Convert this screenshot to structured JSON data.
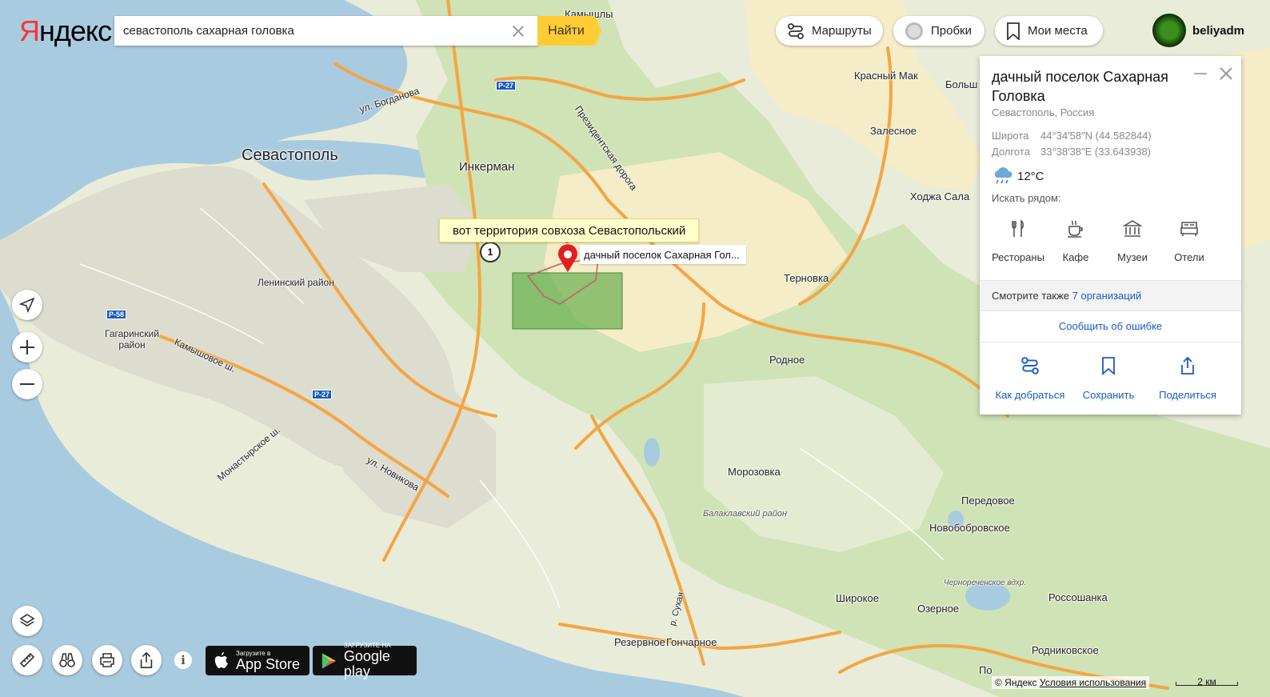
{
  "header": {
    "logo": "Яндекс",
    "search_value": "севастополь сахарная головка",
    "find_label": "Найти",
    "routes_label": "Маршруты",
    "traffic_label": "Пробки",
    "places_label": "Мои места",
    "username": "beliyadm"
  },
  "panel": {
    "title": "дачный поселок Сахарная Головка",
    "subtitle": "Севастополь, Россия",
    "lat_label": "Широта",
    "lat_value": "44°34′58″N (44.582844)",
    "lon_label": "Долгота",
    "lon_value": "33°38′38″E (33.643938)",
    "temperature": "12°C",
    "weather_icon": "rain-cloud-icon",
    "nearby_label": "Искать рядом:",
    "categories": [
      {
        "label": "Рестораны",
        "icon": "fork-knife-icon"
      },
      {
        "label": "Кафе",
        "icon": "coffee-cup-icon"
      },
      {
        "label": "Музеи",
        "icon": "museum-icon"
      },
      {
        "label": "Отели",
        "icon": "bed-icon"
      }
    ],
    "see_also_prefix": "Смотрите также",
    "see_also_link": "7 организаций",
    "report_label": "Сообщить об ошибке",
    "actions": [
      {
        "label": "Как добраться",
        "icon": "route-icon"
      },
      {
        "label": "Сохранить",
        "icon": "bookmark-icon"
      },
      {
        "label": "Поделиться",
        "icon": "share-icon"
      }
    ]
  },
  "map": {
    "tooltip": "вот территория совхоза Севастопольский",
    "pin_label": "дачный поселок Сахарная Гол...",
    "cluster_count": "1",
    "labels": {
      "sevastopol": "Севастополь",
      "inkerman": "Инкерман",
      "leninsky": "Ленинский район",
      "gagarinsky": "Гагаринский район",
      "balaklavsky": "Балаклавский район",
      "kamyshi": "Камышлы",
      "krasny_mak": "Красный Мак",
      "bolsh": "Больш",
      "zalesnoe": "Залесное",
      "khodzha_sala": "Ходжа Сала",
      "ternovka": "Терновка",
      "rodnoe": "Родное",
      "morozovka": "Морозовка",
      "peredovoe": "Передовое",
      "novobobrovskoe": "Новобобровское",
      "chernorechenskoe": "Чернореченское вдхр.",
      "shirokoe": "Широкое",
      "ozernoe": "Озерное",
      "rossoshanka": "Россошанка",
      "rodnikovskoe": "Родниковское",
      "rezervnoe": "Резервное",
      "goncharnoe": "Гончарное",
      "po": "По",
      "ul_bogdanova": "ул. Богданова",
      "prezidentskaya": "Президентская дорога",
      "kamyshovoe": "Камышовое ш.",
      "monastyrskoe": "Монастырское ш.",
      "ul_novikova": "ул. Новикова",
      "r_sukhaya": "р. Сухая",
      "r27a": "Р-27",
      "r27b": "Р-27",
      "r58": "Р-58"
    }
  },
  "footer": {
    "appstore_small": "Загрузите в",
    "appstore_big": "App Store",
    "gplay_small": "ЗАГРУЗИТЕ НА",
    "gplay_big": "Google play",
    "copyright": "© Яндекс",
    "terms": "Условия использования",
    "scale": "2 км"
  },
  "colors": {
    "sea": "#a9cbe0",
    "land": "#e9ecd9",
    "forest": "#cfe3b6",
    "field": "#f5ecc8",
    "urban": "#dcdccf",
    "major_road": "#f4a543",
    "highlight": "#5daa45",
    "accent": "#ffcc33",
    "link": "#1a5bc2"
  }
}
